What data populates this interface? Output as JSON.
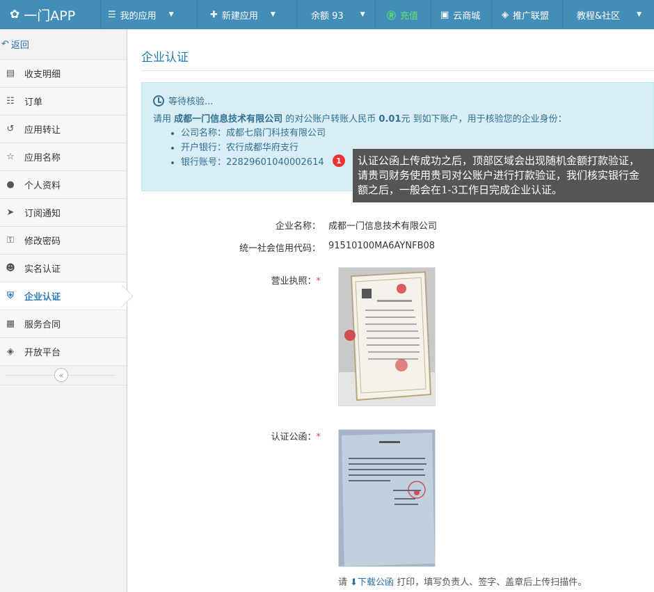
{
  "nav": {
    "brand": "一门APP",
    "items": [
      {
        "icon": "list-icon",
        "label": "我的应用",
        "caret": true
      },
      {
        "icon": "plus-icon",
        "label": "新建应用",
        "caret": true
      },
      {
        "icon": "",
        "label": "余额 93",
        "caret": true
      },
      {
        "icon": "recharge-icon",
        "label": "充值",
        "caret": false
      },
      {
        "icon": "store-icon",
        "label": "云商城",
        "caret": false
      },
      {
        "icon": "diamond-icon",
        "label": "推广联盟",
        "caret": false
      },
      {
        "icon": "",
        "label": "教程&社区",
        "caret": true
      }
    ]
  },
  "sidebar": {
    "back": "返回",
    "items": [
      {
        "label": "收支明细"
      },
      {
        "label": "订单"
      },
      {
        "label": "应用转让"
      },
      {
        "label": "应用名称"
      },
      {
        "label": "个人资料"
      },
      {
        "label": "订阅通知"
      },
      {
        "label": "修改密码"
      },
      {
        "label": "实名认证"
      },
      {
        "label": "企业认证",
        "active": true
      },
      {
        "label": "服务合同"
      },
      {
        "label": "开放平台"
      }
    ]
  },
  "page": {
    "title": "企业认证",
    "info": {
      "status": "等待核验...",
      "line_prefix": "请用 ",
      "company_bold": "成都一门信息技术有限公司",
      "line_mid": " 的对公账户转账人民币 ",
      "amount_bold": "0.01",
      "line_suffix": "元 到如下账户，用于核验您的企业身份：",
      "accounts": [
        "公司名称：成都七扇门科技有限公司",
        "开户银行：农行成都华府支行",
        "银行账号：22829601040002614"
      ]
    },
    "tooltip": {
      "badge": "1",
      "text": "认证公函上传成功之后，顶部区域会出现随机金额打款验证，请贵司财务使用贵司对公账户进行打款验证，我们核实银行金额之后，一般会在1-3工作日完成企业认证。"
    },
    "form": {
      "company_label": "企业名称：",
      "company_value": "成都一门信息技术有限公司",
      "credit_label": "统一社会信用代码：",
      "credit_value": "91510100MA6AYNFB08",
      "license_label": "营业执照：",
      "letter_label": "认证公函：",
      "required_mark": "*"
    },
    "hint": {
      "prefix": "请 ",
      "link": "下载公函",
      "suffix": " 打印，填写负责人、签字、盖章后上传扫描件。"
    }
  }
}
